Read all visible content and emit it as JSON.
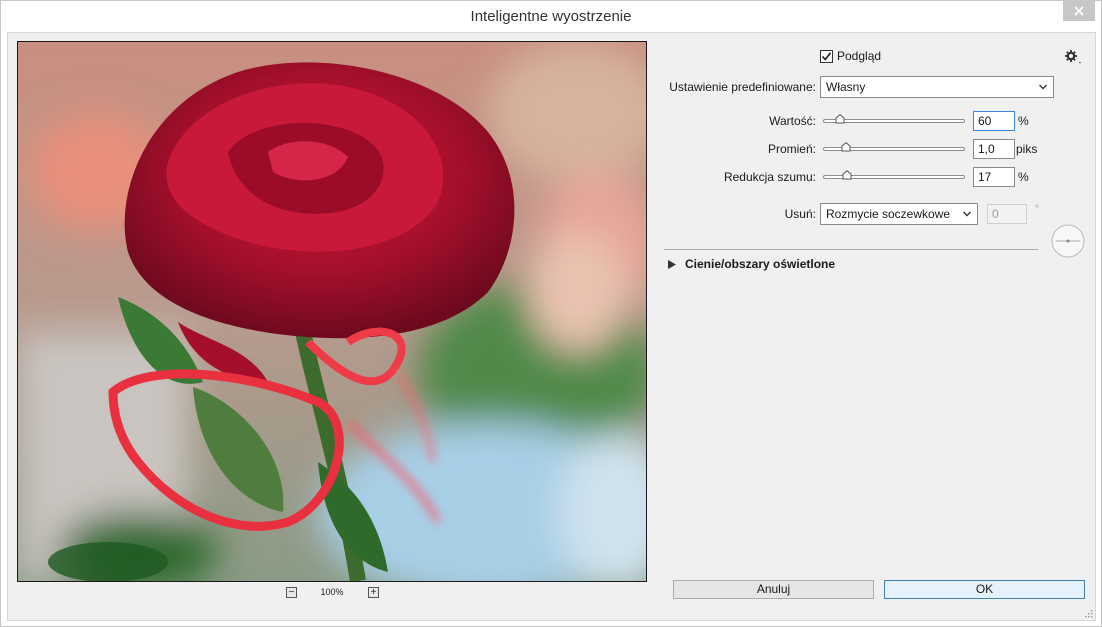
{
  "window": {
    "title": "Inteligentne wyostrzenie"
  },
  "zoom": {
    "value": "100%",
    "minus": "−",
    "plus": "+"
  },
  "preview": {
    "label": "Podgląd",
    "checked": true
  },
  "preset": {
    "label": "Ustawienie predefiniowane:",
    "value": "Własny"
  },
  "amount": {
    "label": "Wartość:",
    "value": "60",
    "unit": "%",
    "level": 0.12
  },
  "radius": {
    "label": "Promień:",
    "value": "1,0",
    "unit": "piks",
    "level": 0.16
  },
  "noise": {
    "label": "Redukcja szumu:",
    "value": "17",
    "unit": "%",
    "level": 0.17
  },
  "remove": {
    "label": "Usuń:",
    "value": "Rozmycie soczewkowe",
    "angle": "0",
    "angle_unit": "°"
  },
  "shadows": {
    "label": "Cienie/obszary oświetlone"
  },
  "buttons": {
    "cancel": "Anuluj",
    "ok": "OK"
  },
  "colors": {
    "accent": "#3b86d6",
    "rose": "#b0122e",
    "ribbon": "#e8303e"
  }
}
